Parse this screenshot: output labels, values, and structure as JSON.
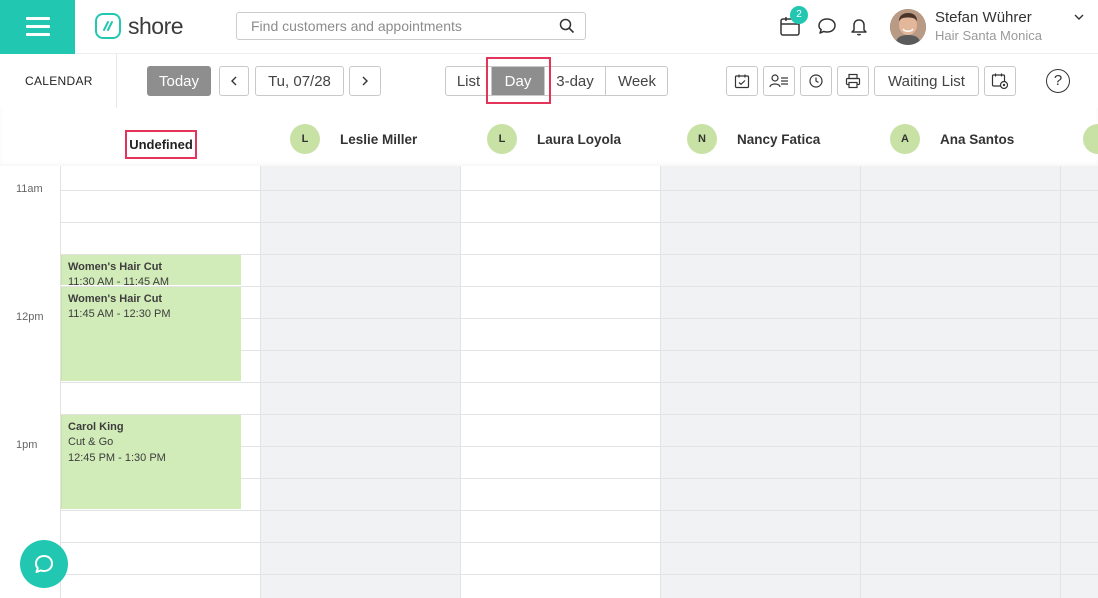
{
  "header": {
    "logo_text": "shore",
    "search_placeholder": "Find customers and appointments",
    "notification_badge": "2",
    "user_name": "Stefan Wührer",
    "user_location": "Hair Santa Monica"
  },
  "toolbar": {
    "section_title": "CALENDAR",
    "today_label": "Today",
    "current_date": "Tu, 07/28",
    "views": [
      "List",
      "Day",
      "3-day",
      "Week"
    ],
    "active_view": "Day",
    "waiting_list_label": "Waiting List",
    "help_label": "?"
  },
  "staff": {
    "undefined_label": "Undefined",
    "members": [
      {
        "initial": "L",
        "name": "Leslie Miller"
      },
      {
        "initial": "L",
        "name": "Laura Loyola"
      },
      {
        "initial": "N",
        "name": "Nancy Fatica"
      },
      {
        "initial": "A",
        "name": "Ana Santos"
      }
    ]
  },
  "times": [
    "11am",
    "12pm",
    "1pm"
  ],
  "appointments": [
    {
      "title": "Women's Hair Cut",
      "time": "11:30 AM - 11:45 AM",
      "customer": ""
    },
    {
      "title": "Women's Hair Cut",
      "time": "11:45 AM - 12:30 PM",
      "customer": ""
    },
    {
      "title": "Carol King",
      "service": "Cut & Go",
      "time": "12:45 PM - 1:30 PM"
    }
  ],
  "colors": {
    "brand": "#22c7b2",
    "appointment": "#d2ecb9",
    "highlight": "#e5345a",
    "active_button": "#8e8e8e",
    "staff_avatar": "#c8e2a6"
  }
}
